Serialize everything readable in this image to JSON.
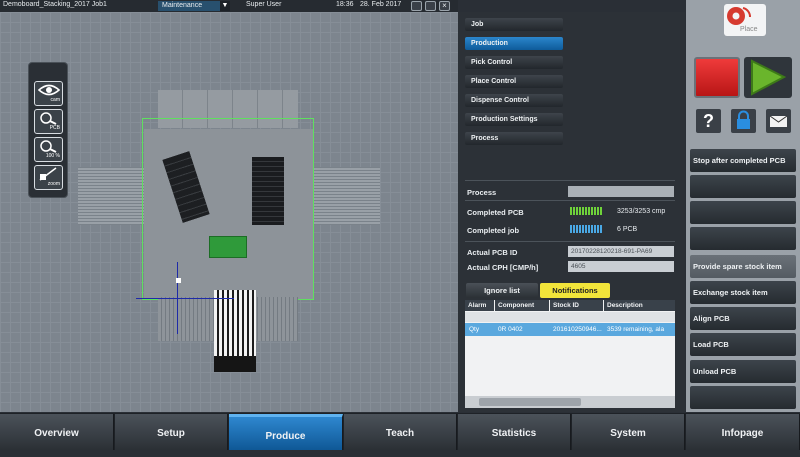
{
  "topbar": {
    "job": "Demoboard_Stacking_2017 Job1",
    "mode": "Maintenance",
    "user": "Super User",
    "time": "18:36",
    "date": "28. Feb 2017"
  },
  "camera_tools": {
    "items": [
      {
        "label": "cam",
        "icon": "eye-icon"
      },
      {
        "label": "PCB",
        "icon": "pcb-search-icon"
      },
      {
        "label": "100 %",
        "icon": "zoom-100-icon"
      },
      {
        "label": "zoom",
        "icon": "zoom-icon"
      }
    ]
  },
  "menu": {
    "items": [
      "Job",
      "Production",
      "Pick Control",
      "Place Control",
      "Dispense Control",
      "Production Settings",
      "Process"
    ],
    "active": "Production"
  },
  "status": {
    "process_label": "Process",
    "completed_pcb_label": "Completed PCB",
    "completed_pcb_value": "3253/3253 cmp",
    "completed_job_label": "Completed job",
    "completed_job_value": "6 PCB",
    "actual_pcb_id_label": "Actual PCB ID",
    "actual_pcb_id_value": "20170228120218-691-PA69",
    "actual_cph_label": "Actual CPH [CMP/h]",
    "actual_cph_value": "4605"
  },
  "tabs": {
    "ignore": "Ignore list",
    "notifications": "Notifications"
  },
  "table": {
    "headers": [
      "Alarm",
      "Component",
      "Stock ID",
      "Description"
    ],
    "rows": [
      [
        "Qty",
        "0R 0402",
        "201610250946...",
        "3539 remaining, ala"
      ]
    ]
  },
  "logo": {
    "text": "Place"
  },
  "actions": [
    "Stop after completed PCB",
    "",
    "",
    "",
    "Provide spare stock item",
    "Exchange stock item",
    "Align PCB",
    "Load PCB",
    "Unload PCB",
    ""
  ],
  "nav": {
    "items": [
      "Overview",
      "Setup",
      "Produce",
      "Teach",
      "Statistics",
      "System",
      "Infopage"
    ],
    "active": "Produce"
  },
  "colors": {
    "accent": "#1a78c2",
    "notifications_tab": "#f2e53a",
    "stop_button": "#d9282a",
    "start_button": "#63a62d",
    "selected_row": "#5aa8de"
  }
}
